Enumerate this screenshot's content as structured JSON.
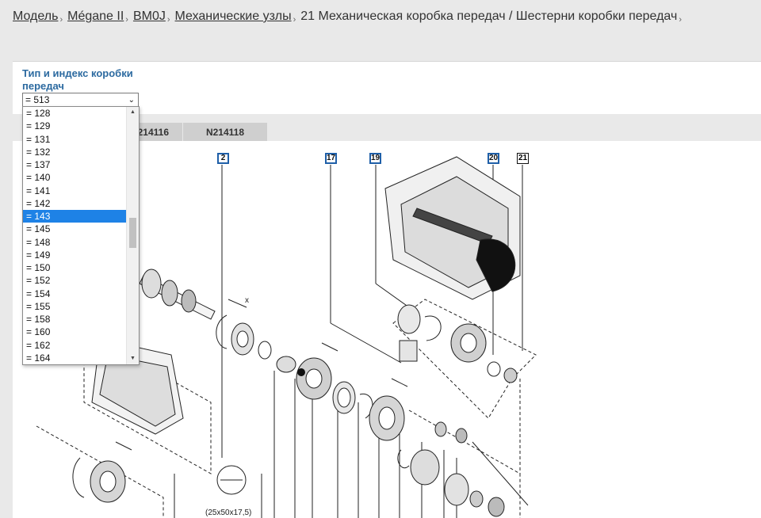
{
  "breadcrumb": {
    "items": [
      "Модель",
      "Mégane II",
      "BM0J",
      "Механические узлы"
    ],
    "current": "21 Механическая коробка передач / Шестерни коробки передач",
    "separator": "›"
  },
  "filter": {
    "label": "Тип и индекс коробки передач",
    "selected_value": "= 513",
    "options": [
      "= 128",
      "= 129",
      "= 131",
      "= 132",
      "= 137",
      "= 140",
      "= 141",
      "= 142",
      "= 143",
      "= 145",
      "= 148",
      "= 149",
      "= 150",
      "= 152",
      "= 154",
      "= 155",
      "= 158",
      "= 160",
      "= 162",
      "= 164"
    ],
    "highlighted_option": "= 143",
    "scroll_up_icon": "▲",
    "scroll_down_icon": "▼",
    "chevron_icon": "⌄"
  },
  "tabs": [
    {
      "label": "N214116"
    },
    {
      "label": "N214118"
    }
  ],
  "diagram": {
    "callouts": [
      "2",
      "17",
      "19",
      "20",
      "21"
    ],
    "dimension_text": "(25x50x17,5)",
    "axis_mark": "x"
  },
  "colors": {
    "accent_label": "#2c6aa0",
    "selected_option": "#1e82e6",
    "callout_border": "#1f5fa8",
    "tab_background": "#cfcfcf"
  }
}
